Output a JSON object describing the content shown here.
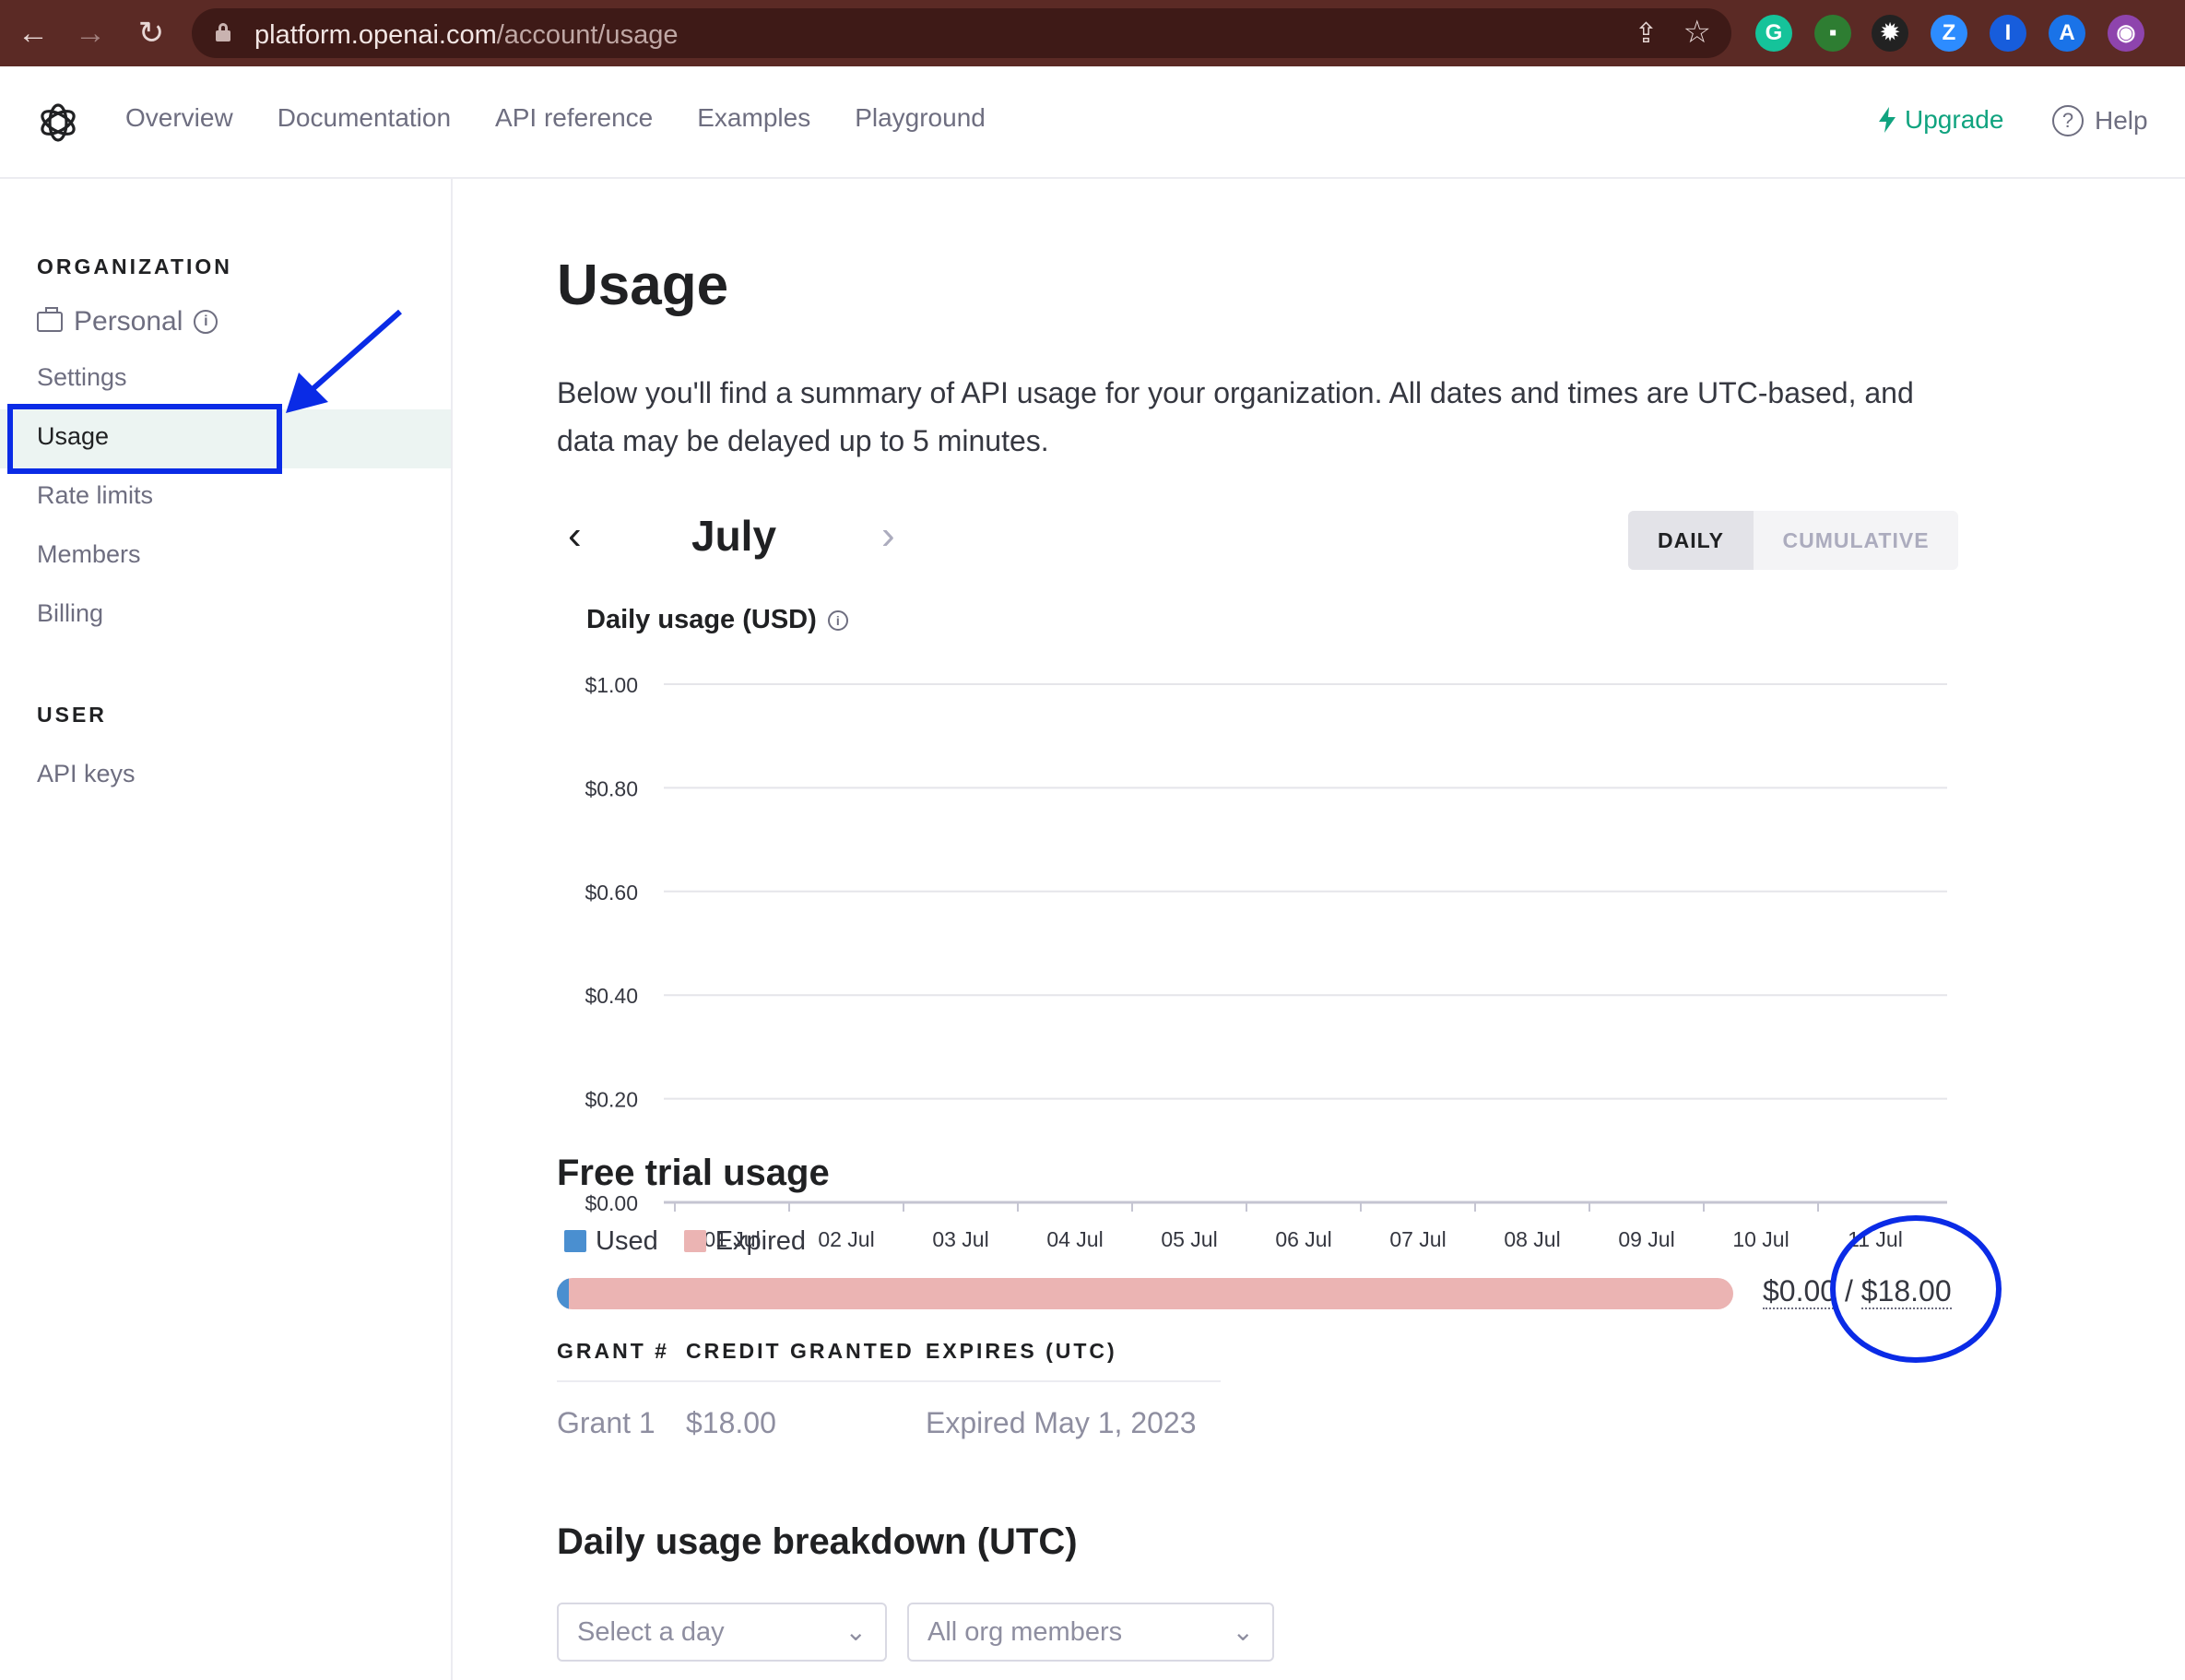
{
  "browser": {
    "url_host": "platform.openai.com",
    "url_path": "/account/usage",
    "extensions": [
      {
        "icon": "grammarly-icon",
        "color": "#15c39a",
        "glyph": "G"
      },
      {
        "icon": "extension-green-icon",
        "color": "#2e7d32",
        "glyph": "▪"
      },
      {
        "icon": "extension-gear-icon",
        "color": "#222222",
        "glyph": "✹"
      },
      {
        "icon": "zoom-icon",
        "color": "#2d8cff",
        "glyph": "Z"
      },
      {
        "icon": "bitwarden-icon",
        "color": "#175ddc",
        "glyph": "I"
      },
      {
        "icon": "translate-icon",
        "color": "#1a73e8",
        "glyph": "A"
      },
      {
        "icon": "extension-globe-icon",
        "color": "#8e44ad",
        "glyph": "◉"
      }
    ]
  },
  "header": {
    "nav": [
      "Overview",
      "Documentation",
      "API reference",
      "Examples",
      "Playground"
    ],
    "upgrade_label": "Upgrade",
    "help_label": "Help",
    "accent": "#10a37f"
  },
  "sidebar": {
    "org_heading": "ORGANIZATION",
    "org_name": "Personal",
    "org_items": [
      "Settings",
      "Usage",
      "Rate limits",
      "Members",
      "Billing"
    ],
    "active_item": "Usage",
    "user_heading": "USER",
    "user_items": [
      "API keys"
    ]
  },
  "main": {
    "title": "Usage",
    "description": "Below you'll find a summary of API usage for your organization. All dates and times are UTC-based, and data may be delayed up to 5 minutes.",
    "month": "July",
    "toggle": {
      "daily": "DAILY",
      "cumulative": "CUMULATIVE",
      "selected": "DAILY"
    },
    "chart_title": "Daily usage (USD)",
    "free_trial": {
      "title": "Free trial usage",
      "legend_used": "Used",
      "legend_expired": "Expired",
      "used_color": "#4a8fd0",
      "expired_color": "#ebb4b3",
      "used_fraction": 0.01,
      "used_amount": "$0.00",
      "separator": "/",
      "total_amount": "$18.00",
      "table_headers": [
        "GRANT #",
        "CREDIT GRANTED",
        "EXPIRES (UTC)"
      ],
      "rows": [
        [
          "Grant 1",
          "$18.00",
          "Expired May 1, 2023"
        ]
      ]
    },
    "breakdown": {
      "title": "Daily usage breakdown (UTC)",
      "day_placeholder": "Select a day",
      "member_value": "All org members"
    }
  },
  "chart_data": {
    "type": "bar",
    "title": "Daily usage (USD)",
    "categories": [
      "01 Jul",
      "02 Jul",
      "03 Jul",
      "04 Jul",
      "05 Jul",
      "06 Jul",
      "07 Jul",
      "08 Jul",
      "09 Jul",
      "10 Jul",
      "11 Jul"
    ],
    "values": [
      0,
      0,
      0,
      0,
      0,
      0,
      0,
      0,
      0,
      0,
      0
    ],
    "ylim": [
      0,
      1
    ],
    "yticks": [
      "$0.00",
      "$0.20",
      "$0.40",
      "$0.60",
      "$0.80",
      "$1.00"
    ],
    "grid": true
  }
}
